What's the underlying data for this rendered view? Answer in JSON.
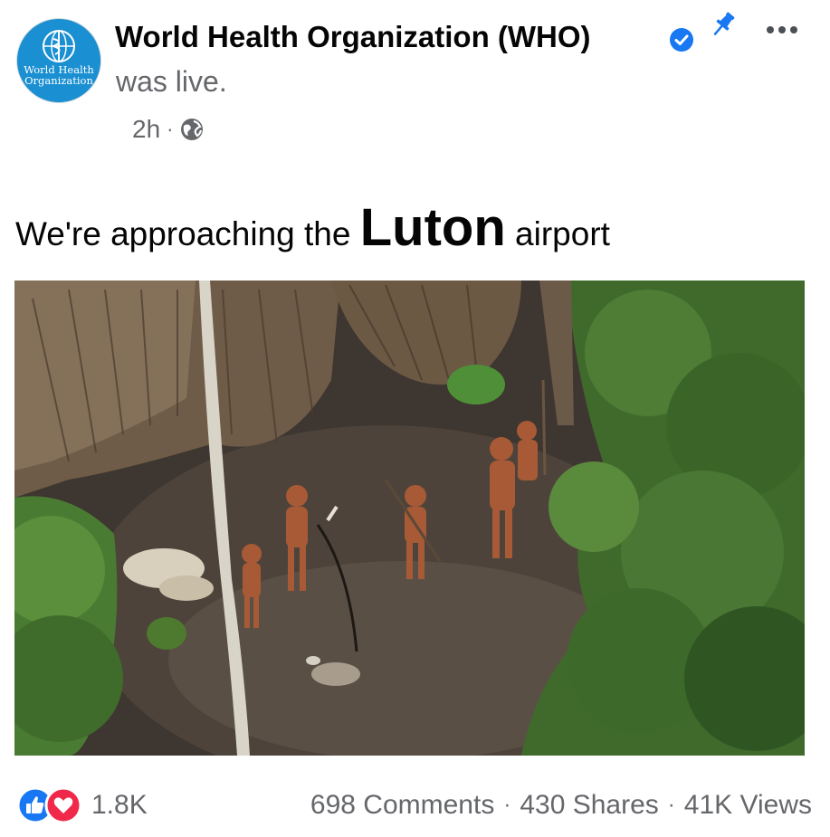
{
  "header": {
    "page_name": "World Health Organization (WHO)",
    "status": "was live.",
    "time": "2h",
    "dot": "·",
    "avatar_text_line1": "World Health",
    "avatar_text_line2": "Organization",
    "icons": {
      "verified": "verified-badge-icon",
      "pin": "pin-icon",
      "more": "more-options-icon",
      "privacy": "globe-icon"
    }
  },
  "caption": {
    "before": "We're approaching the ",
    "emphasis": "Luton",
    "after": " airport"
  },
  "photo": {
    "description_icon": "aerial-photo"
  },
  "footer": {
    "reaction_count": "1.8K",
    "comments": "698 Comments",
    "shares": "430 Shares",
    "views": "41K Views",
    "separator": "·",
    "reaction_icons": [
      "like-icon",
      "love-icon"
    ]
  },
  "colors": {
    "verified": "#1877f2",
    "secondary_text": "#65676b",
    "like": "#1877f2",
    "love": "#f0284a",
    "avatar": "#1a8fd1"
  }
}
